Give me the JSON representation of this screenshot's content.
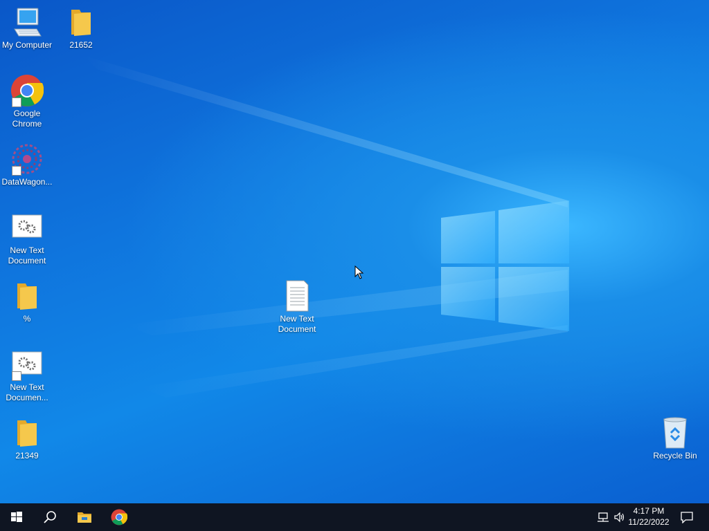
{
  "desktop": {
    "icons": [
      {
        "label": "My Computer",
        "icon": "computer-icon"
      },
      {
        "label": "21652",
        "icon": "folder-icon"
      },
      {
        "label": "Google Chrome",
        "icon": "chrome-icon"
      },
      {
        "label": "DataWagon...",
        "icon": "datawagon-icon"
      },
      {
        "label": "New Text Document",
        "icon": "settings-document-icon"
      },
      {
        "label": "%",
        "icon": "folder-icon"
      },
      {
        "label": "New Text Documen...",
        "icon": "settings-document-icon"
      },
      {
        "label": "21349",
        "icon": "folder-icon"
      },
      {
        "label": "New Text Document",
        "icon": "text-document-icon"
      },
      {
        "label": "Recycle Bin",
        "icon": "recycle-bin-icon"
      }
    ]
  },
  "taskbar": {
    "start_icon": "windows-start-icon",
    "search_icon": "search-icon",
    "pinned": [
      {
        "icon": "file-explorer-icon"
      },
      {
        "icon": "chrome-icon"
      }
    ],
    "tray": {
      "time": "4:17 PM",
      "date": "11/22/2022",
      "network_icon": "network-icon",
      "volume_icon": "volume-icon",
      "notification_icon": "notification-icon"
    }
  },
  "colors": {
    "taskbar_bg": "#0f1522",
    "desktop_blue": "#0f74dd",
    "folder_yellow": "#f5c84c"
  }
}
